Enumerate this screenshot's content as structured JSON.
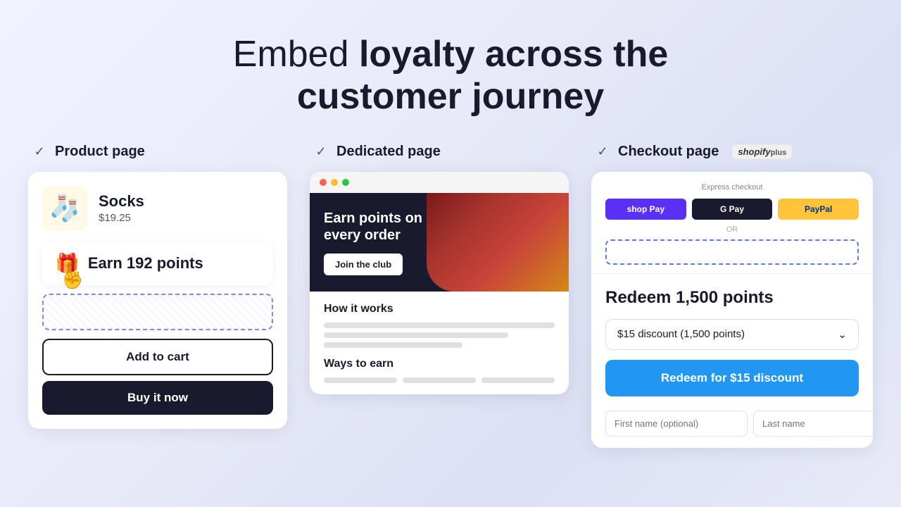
{
  "header": {
    "line1_light": "Embed",
    "line1_bold": "loyalty across the",
    "line2_bold": "customer journey"
  },
  "columns": [
    {
      "id": "product-page",
      "label": "Product page",
      "checkmark": "✓"
    },
    {
      "id": "dedicated-page",
      "label": "Dedicated page",
      "checkmark": "✓"
    },
    {
      "id": "checkout-page",
      "label": "Checkout page",
      "checkmark": "✓",
      "badge": "shopify plus"
    }
  ],
  "product_card": {
    "product_name": "Socks",
    "product_price": "$19.25",
    "earn_points_text": "Earn 192 points",
    "add_to_cart_label": "Add to cart",
    "buy_now_label": "Buy it now"
  },
  "dedicated_card": {
    "hero_title": "Earn points on every order",
    "join_club_label": "Join the club",
    "how_it_works_label": "How it works",
    "ways_to_earn_label": "Ways to earn"
  },
  "checkout_card": {
    "express_checkout_label": "Express checkout",
    "or_label": "OR",
    "redeem_title": "Redeem 1,500 points",
    "discount_option": "$15 discount (1,500 points)",
    "redeem_button_label": "Redeem for $15 discount",
    "first_name_placeholder": "First name (optional)",
    "last_name_placeholder": "Last name"
  },
  "icons": {
    "checkmark": "✓",
    "gift": "🎁",
    "cursor": "✊",
    "chevron_down": "⌄",
    "sock": "🧦"
  }
}
